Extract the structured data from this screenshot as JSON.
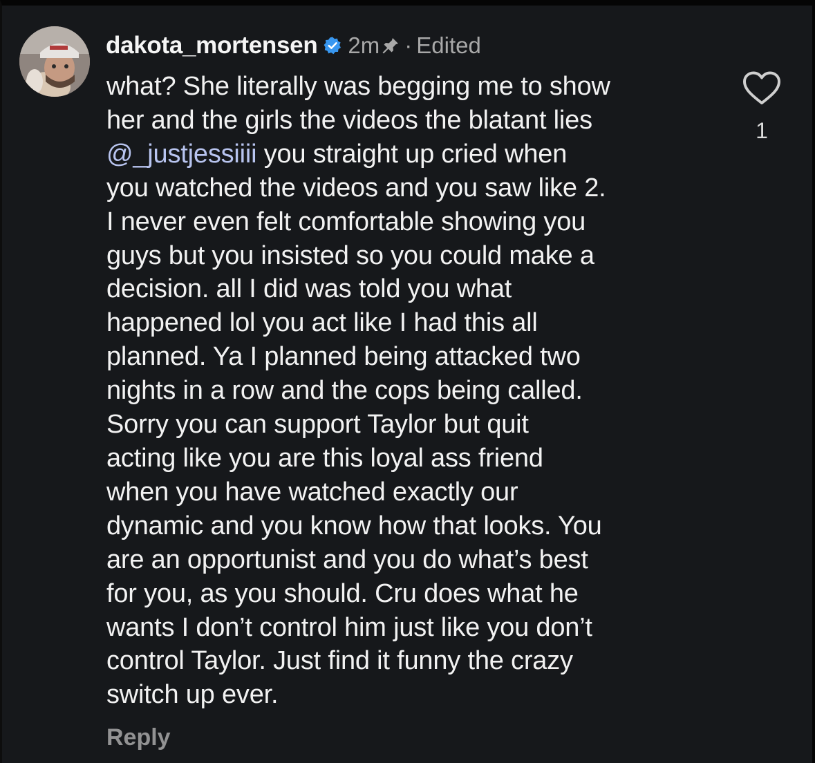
{
  "comment": {
    "username": "dakota_mortensen",
    "time": "2m",
    "separator": "·",
    "edited_label": "Edited",
    "lines": [
      "what? She literally was begging me to show",
      "her and the girls the videos the blatant lies",
      "you straight up cried when",
      "you watched the videos and you saw like 2.",
      "I never even felt comfortable showing you",
      "guys but you insisted so you could make a",
      "decision. all I did was told you what",
      "happened lol you act like I had this all",
      "planned. Ya I planned being attacked two",
      "nights in a row and the cops being called.",
      "Sorry you can support Taylor but quit",
      "acting like you are this loyal ass friend",
      "when you have watched exactly our",
      "dynamic and you know how that looks. You",
      "are an opportunist and you do what’s best",
      "for you, as you should. Cru does what he",
      "wants I don’t control him just like you don’t",
      "control Taylor. Just find it funny the crazy",
      "switch up ever."
    ],
    "mention": "@_justjessiiii",
    "reply_label": "Reply",
    "like_count": "1"
  },
  "colors": {
    "background": "#16181b",
    "text": "#f2f2f2",
    "muted": "#a8a8a8",
    "mention": "#b8c4ef",
    "verified_badge": "#3897f0"
  },
  "icons": {
    "avatar": "profile-photo",
    "verified": "verified-badge-icon",
    "pin": "pin-icon",
    "like": "heart-outline-icon"
  }
}
